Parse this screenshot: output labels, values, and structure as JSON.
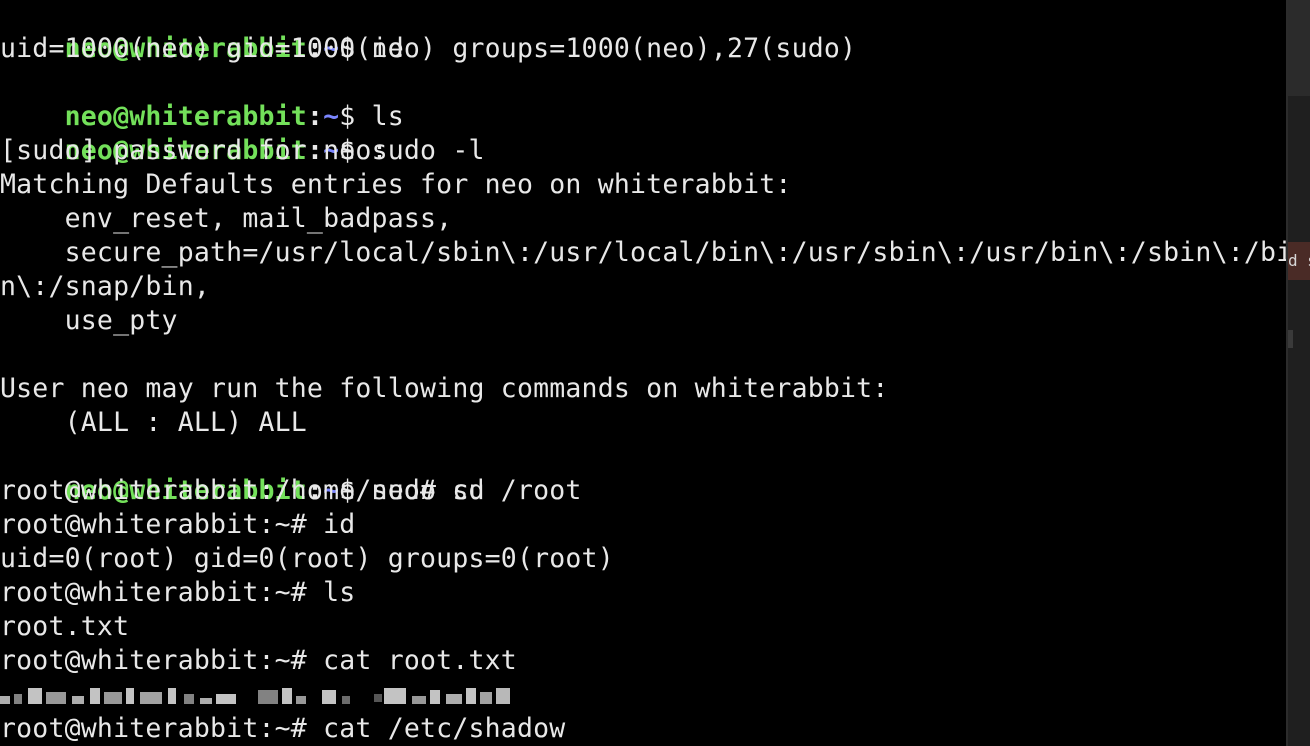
{
  "terminal": {
    "prompts": {
      "user": "neo@whiterabbit",
      "colon": ":",
      "path": "~",
      "dollar": "$ "
    },
    "lines": [
      {
        "type": "prompt",
        "cmd": "id"
      },
      {
        "type": "text",
        "text": "uid=1000(neo) gid=1000(neo) groups=1000(neo),27(sudo)"
      },
      {
        "type": "prompt",
        "cmd": "ls"
      },
      {
        "type": "prompt",
        "cmd": "sudo -l"
      },
      {
        "type": "text",
        "text": "[sudo] password for neo:"
      },
      {
        "type": "text",
        "text": "Matching Defaults entries for neo on whiterabbit:"
      },
      {
        "type": "text",
        "text": "    env_reset, mail_badpass,"
      },
      {
        "type": "text",
        "text": "    secure_path=/usr/local/sbin\\:/usr/local/bin\\:/usr/sbin\\:/usr/bin\\:/sbin\\:/bi"
      },
      {
        "type": "text",
        "text": "n\\:/snap/bin,"
      },
      {
        "type": "text",
        "text": "    use_pty"
      },
      {
        "type": "text",
        "text": ""
      },
      {
        "type": "text",
        "text": "User neo may run the following commands on whiterabbit:"
      },
      {
        "type": "text",
        "text": "    (ALL : ALL) ALL"
      },
      {
        "type": "prompt",
        "cmd": "sudo su"
      },
      {
        "type": "text",
        "text": "root@whiterabbit:/home/neo# cd /root"
      },
      {
        "type": "text",
        "text": "root@whiterabbit:~# id"
      },
      {
        "type": "text",
        "text": "uid=0(root) gid=0(root) groups=0(root)"
      },
      {
        "type": "text",
        "text": "root@whiterabbit:~# ls"
      },
      {
        "type": "text",
        "text": "root.txt"
      },
      {
        "type": "text",
        "text": "root@whiterabbit:~# cat root.txt"
      },
      {
        "type": "redacted"
      },
      {
        "type": "text",
        "text": "root@whiterabbit:~# cat /etc/shadow"
      }
    ]
  },
  "side_panel": {
    "highlight_text": "d s"
  },
  "colors": {
    "background": "#000000",
    "text": "#e8e8e8",
    "user": "#73e05a",
    "path": "#7b86ff"
  }
}
